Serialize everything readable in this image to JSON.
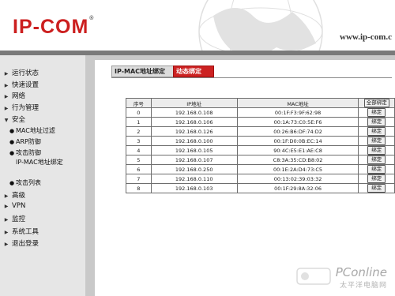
{
  "header": {
    "logo": "IP-COM",
    "tm": "®",
    "url": "www.ip-com.c"
  },
  "sidebar": {
    "items": [
      {
        "label": "运行状态"
      },
      {
        "label": "快速设置"
      },
      {
        "label": "网络"
      },
      {
        "label": "行为管理"
      },
      {
        "label": "安全",
        "expanded": true
      },
      {
        "label": "高级"
      },
      {
        "label": "VPN"
      },
      {
        "label": "监控"
      },
      {
        "label": "系统工具"
      },
      {
        "label": "退出登录"
      }
    ],
    "sub_items": [
      {
        "label": "MAC地址过滤"
      },
      {
        "label": "ARP防御"
      },
      {
        "label": "攻击防御"
      },
      {
        "label": "IP-MAC地址绑定"
      },
      {
        "label": "攻击列表"
      }
    ]
  },
  "tabs": {
    "ipmac": "IP-MAC地址绑定",
    "dynamic": "动态绑定"
  },
  "table": {
    "headers": {
      "no": "序号",
      "ip": "IP地址",
      "mac": "MAC地址",
      "bind_all": "全部绑定"
    },
    "bind_label": "绑定",
    "rows": [
      {
        "no": "0",
        "ip": "192.168.0.108",
        "mac": "00:1F:F3:9F:62:98"
      },
      {
        "no": "1",
        "ip": "192.168.0.106",
        "mac": "00:1A:73:C0:5E:F6"
      },
      {
        "no": "2",
        "ip": "192.168.0.126",
        "mac": "00:26:B6:DF:74:D2"
      },
      {
        "no": "3",
        "ip": "192.168.0.100",
        "mac": "00:1F:D0:0B:EC:14"
      },
      {
        "no": "4",
        "ip": "192.168.0.105",
        "mac": "90:4C:E5:E1:AE:C8"
      },
      {
        "no": "5",
        "ip": "192.168.0.107",
        "mac": "C8:3A:35:CD:B8:02"
      },
      {
        "no": "6",
        "ip": "192.168.0.250",
        "mac": "00:1E:2A:D4:73:C5"
      },
      {
        "no": "7",
        "ip": "192.168.0.110",
        "mac": "00:13:02:39:03:32"
      },
      {
        "no": "8",
        "ip": "192.168.0.103",
        "mac": "00:1F:29:8A:32:06"
      }
    ]
  },
  "watermark": {
    "brand": "PConline",
    "sub": "太平洋电脑网"
  },
  "colors": {
    "brand_red": "#cc1f1f",
    "active_tab": "#cc2222",
    "sidebar_bg": "#e6e6e6",
    "content_frame": "#c9c9c9"
  }
}
